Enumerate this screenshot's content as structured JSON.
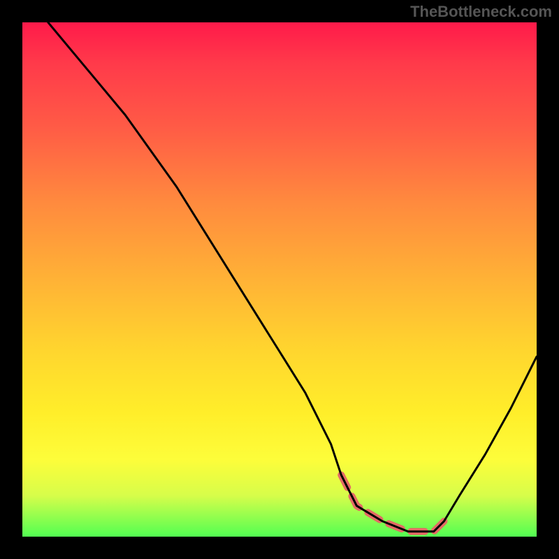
{
  "attribution": "TheBottleneck.com",
  "chart_data": {
    "type": "line",
    "title": "",
    "xlabel": "",
    "ylabel": "",
    "xlim": [
      0,
      100
    ],
    "ylim": [
      0,
      100
    ],
    "series": [
      {
        "name": "bottleneck-curve",
        "x": [
          5,
          10,
          15,
          20,
          25,
          30,
          35,
          40,
          45,
          50,
          55,
          60,
          62,
          65,
          70,
          75,
          80,
          82,
          85,
          90,
          95,
          100
        ],
        "y": [
          100,
          94,
          88,
          82,
          75,
          68,
          60,
          52,
          44,
          36,
          28,
          18,
          12,
          6,
          3,
          1,
          1,
          3,
          8,
          16,
          25,
          35
        ]
      }
    ],
    "highlight_segment": {
      "x": [
        62,
        65,
        70,
        75,
        80,
        82
      ],
      "y": [
        12,
        6,
        3,
        1,
        1,
        3
      ]
    },
    "background_gradient": {
      "top": "#ff1a4a",
      "mid": "#ffd62e",
      "bottom": "#52ff52"
    }
  }
}
